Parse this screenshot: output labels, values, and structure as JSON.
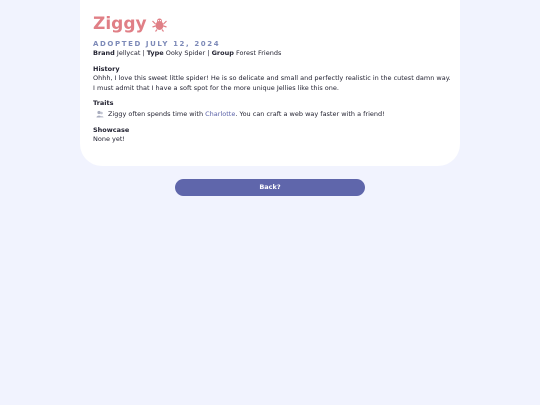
{
  "pet": {
    "name": "Ziggy",
    "adopted_label": "ADOPTED JULY 12, 2024",
    "brand_label": "Brand",
    "brand_value": "Jellycat",
    "sep1": "|",
    "type_label": "Type",
    "type_value": "Ooky Spider",
    "sep2": "|",
    "group_label": "Group",
    "group_value": "Forest Friends",
    "icon": "spider-plush-icon"
  },
  "history": {
    "label": "History",
    "text": "Ohhh, I love this sweet little spider! He is so delicate and small and perfectly realistic in the cutest damn way. I must admit that I have a soft spot for the more unique Jellies like this one."
  },
  "traits": {
    "label": "Traits",
    "item_icon": "friends-icon",
    "item_prefix": "Ziggy often spends time with ",
    "item_link": "Charlotte",
    "item_suffix": ". You can craft a web way faster with a friend!"
  },
  "showcase": {
    "label": "Showcase",
    "text": "None yet!"
  },
  "nav": {
    "back_label": "Back?"
  },
  "colors": {
    "background": "#f1f3fe",
    "accent_name": "#e07f86",
    "adopted": "#7d8ab8",
    "button": "#5f66ab",
    "link": "#5b62a8"
  }
}
